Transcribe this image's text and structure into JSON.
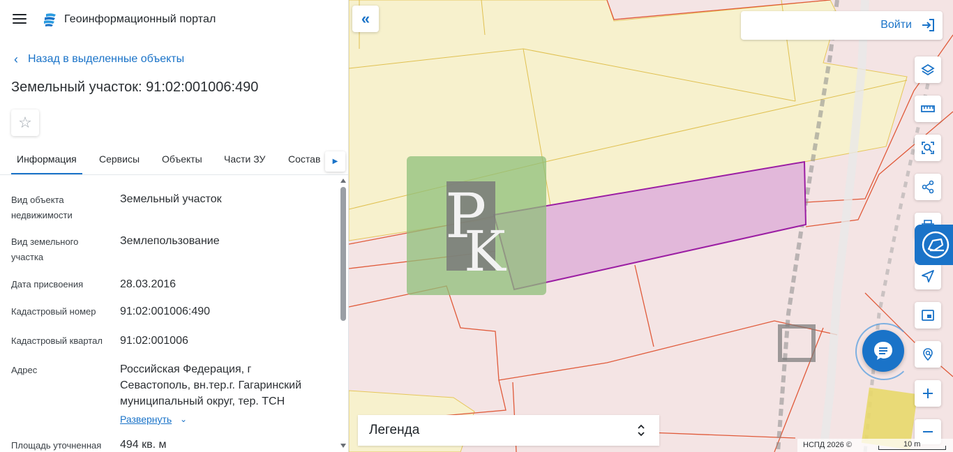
{
  "header": {
    "app_title": "Геоинформационный портал"
  },
  "nav": {
    "back_label": "Назад в выделенные объекты"
  },
  "object": {
    "title": "Земельный участок: 91:02:001006:490"
  },
  "tabs": [
    {
      "label": "Информация",
      "active": true
    },
    {
      "label": "Сервисы",
      "active": false
    },
    {
      "label": "Объекты",
      "active": false
    },
    {
      "label": "Части ЗУ",
      "active": false
    },
    {
      "label": "Состав",
      "active": false
    }
  ],
  "info": {
    "rows": [
      {
        "label": "Вид объекта недвижимости",
        "value": "Земельный участок"
      },
      {
        "label": "Вид земельного участка",
        "value": "Землепользование"
      },
      {
        "label": "Дата присвоения",
        "value": "28.03.2016"
      },
      {
        "label": "Кадастровый номер",
        "value": "91:02:001006:490"
      },
      {
        "label": "Кадастровый квартал",
        "value": "91:02:001006"
      },
      {
        "label": "Адрес",
        "value": "Российская Федерация, г Севастополь, вн.тер.г. Гагаринский муниципальный округ, тер. ТСН"
      },
      {
        "label": "Площадь уточненная",
        "value": "494 кв. м"
      }
    ],
    "expand_label": "Развернуть"
  },
  "map": {
    "login_label": "Войти",
    "legend_label": "Легенда",
    "attribution": "НСПД 2026 ©",
    "scale_label": "10 m",
    "tools": [
      "layers-icon",
      "ruler-icon",
      "select-search-icon",
      "share-icon",
      "print-icon",
      "navigate-icon",
      "minimap-icon",
      "location-search-icon",
      "zoom-in-icon",
      "zoom-out-icon"
    ]
  },
  "colors": {
    "accent": "#1a73c8",
    "parcel_fill": "#e2b8da",
    "parcel_stroke": "#9b1ea3",
    "zone_yellow": "#f7f1cd",
    "zone_pink": "#f4e4e4",
    "boundary": "#e05a3a"
  }
}
